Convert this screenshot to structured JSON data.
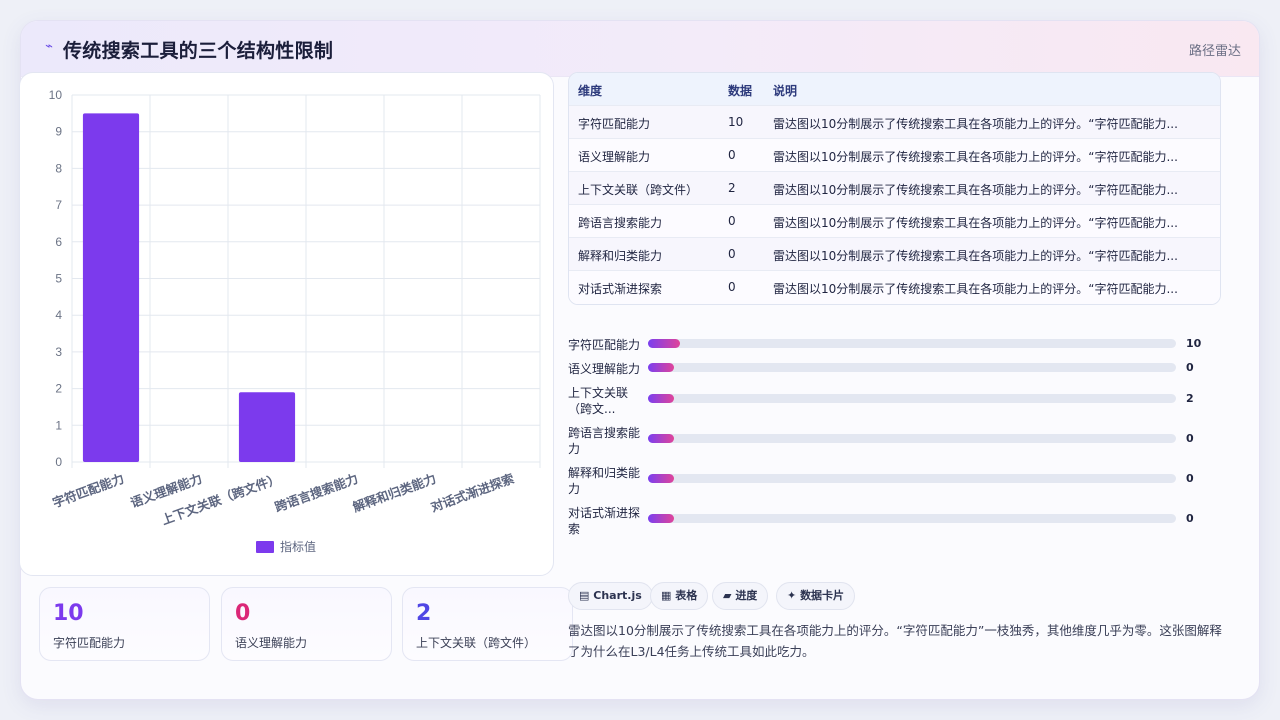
{
  "header": {
    "icon": "pulse-icon",
    "title": "传统搜索工具的三个结构性限制",
    "tag": "路径雷达"
  },
  "colors": {
    "bar": "#7c3aed",
    "accent_purple": "#7c3aed",
    "accent_pink": "#db2777",
    "accent_indigo": "#4f46e5"
  },
  "chart_data": {
    "type": "bar",
    "categories": [
      "字符匹配能力",
      "语义理解能力",
      "上下文关联（跨文件）",
      "跨语言搜索能力",
      "解释和归类能力",
      "对话式渐进探索"
    ],
    "series": [
      {
        "name": "指标值",
        "values": [
          9.5,
          0,
          1.9,
          0,
          0,
          0
        ]
      }
    ],
    "ylim": [
      0,
      10
    ],
    "yticks": [
      "0",
      "1",
      "2",
      "3",
      "4",
      "5",
      "6",
      "7",
      "8",
      "9",
      "10"
    ],
    "grid": true,
    "legend": "bottom"
  },
  "stats": [
    {
      "value": "10",
      "label": "字符匹配能力",
      "color": "#7c3aed"
    },
    {
      "value": "0",
      "label": "语义理解能力",
      "color": "#db2777"
    },
    {
      "value": "2",
      "label": "上下文关联（跨文件）",
      "color": "#4f46e5"
    }
  ],
  "table": {
    "headers": [
      "维度",
      "数据",
      "说明"
    ],
    "rows": [
      {
        "dim": "字符匹配能力",
        "val": "10",
        "note": "雷达图以10分制展示了传统搜索工具在各项能力上的评分。“字符匹配能力..."
      },
      {
        "dim": "语义理解能力",
        "val": "0",
        "note": "雷达图以10分制展示了传统搜索工具在各项能力上的评分。“字符匹配能力..."
      },
      {
        "dim": "上下文关联（跨文件）",
        "val": "2",
        "note": "雷达图以10分制展示了传统搜索工具在各项能力上的评分。“字符匹配能力..."
      },
      {
        "dim": "跨语言搜索能力",
        "val": "0",
        "note": "雷达图以10分制展示了传统搜索工具在各项能力上的评分。“字符匹配能力..."
      },
      {
        "dim": "解释和归类能力",
        "val": "0",
        "note": "雷达图以10分制展示了传统搜索工具在各项能力上的评分。“字符匹配能力..."
      },
      {
        "dim": "对话式渐进探索",
        "val": "0",
        "note": "雷达图以10分制展示了传统搜索工具在各项能力上的评分。“字符匹配能力..."
      }
    ]
  },
  "progress": [
    {
      "label": "字符匹配能力",
      "value": "10",
      "fraction": 0.06
    },
    {
      "label": "语义理解能力",
      "value": "0",
      "fraction": 0.05
    },
    {
      "label": "上下文关联（跨文...",
      "value": "2",
      "fraction": 0.05
    },
    {
      "label": "跨语言搜索能力",
      "value": "0",
      "fraction": 0.05
    },
    {
      "label": "解释和归类能力",
      "value": "0",
      "fraction": 0.05
    },
    {
      "label": "对话式渐进探索",
      "value": "0",
      "fraction": 0.05
    }
  ],
  "chips": [
    {
      "icon": "chart-icon",
      "label": "Chart.js",
      "glyph": "▤"
    },
    {
      "icon": "table-icon",
      "label": "表格",
      "glyph": "▦"
    },
    {
      "icon": "progress-icon",
      "label": "进度",
      "glyph": "▰"
    },
    {
      "icon": "card-icon",
      "label": "数据卡片",
      "glyph": "✦"
    }
  ],
  "description": "雷达图以10分制展示了传统搜索工具在各项能力上的评分。“字符匹配能力”一枝独秀，其他维度几乎为零。这张图解释了为什么在L3/L4任务上传统工具如此吃力。"
}
